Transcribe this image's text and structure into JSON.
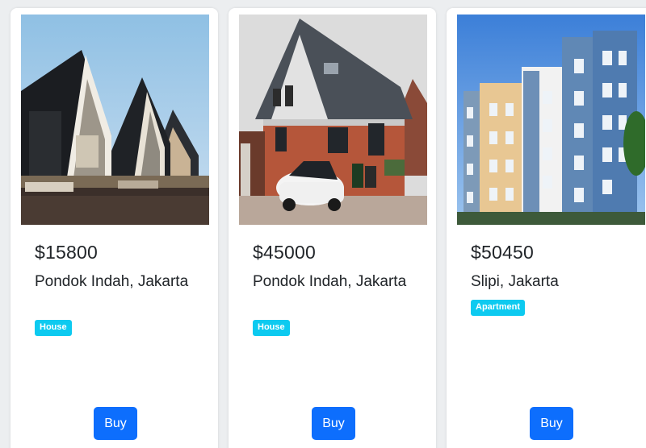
{
  "listings": [
    {
      "price": "$15800",
      "location": "Pondok Indah, Jakarta",
      "type": "House",
      "buy_label": "Buy",
      "photo_icon": "modern-gabled-houses-photo"
    },
    {
      "price": "$45000",
      "location": "Pondok Indah, Jakarta",
      "type": "House",
      "buy_label": "Buy",
      "photo_icon": "brick-house-with-car-photo"
    },
    {
      "price": "$50450",
      "location": "Slipi, Jakarta",
      "type": "Apartment",
      "buy_label": "Buy",
      "photo_icon": "apartment-building-photo"
    }
  ],
  "colors": {
    "badge": "#0dcaf0",
    "button": "#0d6efd",
    "text": "#212529",
    "card": "#ffffff",
    "background": "#eceef0"
  }
}
